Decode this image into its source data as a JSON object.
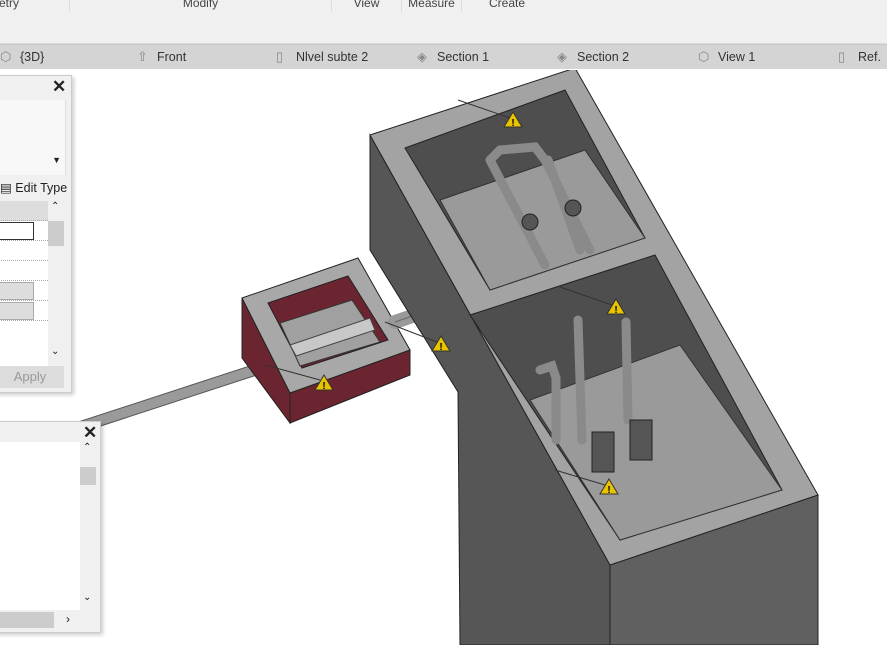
{
  "ribbon": {
    "groups": [
      "etry",
      "Modify",
      "View",
      "Measure",
      "Create"
    ]
  },
  "view_tabs": [
    {
      "label": "{3D}",
      "icon": "3d-view-icon"
    },
    {
      "label": "Front",
      "icon": "elevation-icon"
    },
    {
      "label": "Nlvel subte 2",
      "icon": "floor-plan-icon"
    },
    {
      "label": "Section 1",
      "icon": "section-icon"
    },
    {
      "label": "Section 2",
      "icon": "section-icon"
    },
    {
      "label": "View 1",
      "icon": "3d-view-icon"
    },
    {
      "label": "Ref.",
      "icon": "floor-plan-icon"
    }
  ],
  "properties": {
    "edit_type": "Edit Type",
    "apply": "Apply"
  },
  "colors": {
    "tank_side": "#555555",
    "tank_top": "#a0a0a0",
    "box_side": "#6b2530",
    "warning": "#e8c400"
  }
}
